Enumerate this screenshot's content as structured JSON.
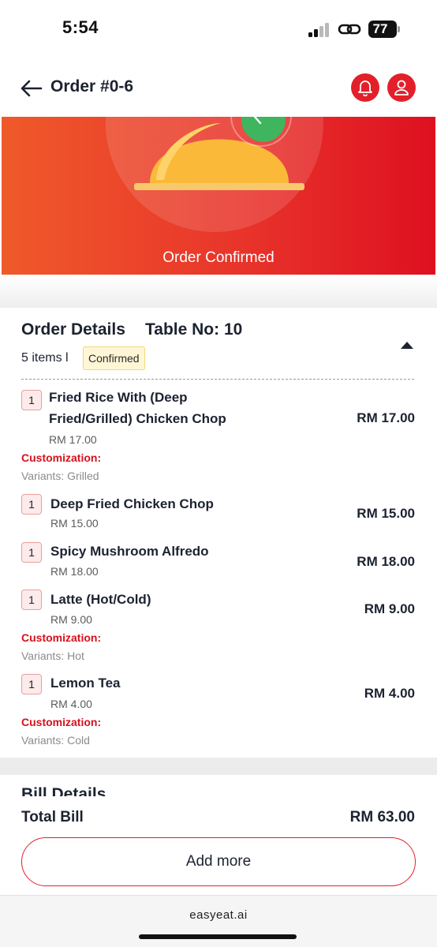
{
  "status_bar": {
    "time": "5:54",
    "battery": "77"
  },
  "header": {
    "title": "Order #0-6",
    "accent_color": "#e3202a"
  },
  "banner": {
    "status_text": "Order Confirmed"
  },
  "order_details": {
    "title": "Order Details",
    "table": "Table No: 10",
    "item_count": "5 items l",
    "status_badge": "Confirmed",
    "items": [
      {
        "qty": "1",
        "name_line1": "Fried Rice With (Deep",
        "name_line2": "Fried/Grilled) Chicken Chop",
        "unit_price": "RM 17.00",
        "total": "RM 17.00",
        "customization_label": "Customization:",
        "customization": "Variants: Grilled"
      },
      {
        "qty": "1",
        "name_line1": "Deep Fried Chicken Chop",
        "unit_price": "RM 15.00",
        "total": "RM 15.00"
      },
      {
        "qty": "1",
        "name_line1": "Spicy Mushroom Alfredo",
        "unit_price": "RM 18.00",
        "total": "RM 18.00"
      },
      {
        "qty": "1",
        "name_line1": "Latte (Hot/Cold)",
        "unit_price": "RM 9.00",
        "total": "RM 9.00",
        "customization_label": "Customization:",
        "customization": "Variants: Hot"
      },
      {
        "qty": "1",
        "name_line1": "Lemon Tea",
        "unit_price": "RM 4.00",
        "total": "RM 4.00",
        "customization_label": "Customization:",
        "customization": "Variants: Cold"
      }
    ]
  },
  "bill": {
    "title": "Bill Details",
    "total_label": "Total Bill",
    "total_value": "RM 63.00"
  },
  "actions": {
    "add_more": "Add more"
  },
  "browser": {
    "domain": "easyeat.ai"
  }
}
